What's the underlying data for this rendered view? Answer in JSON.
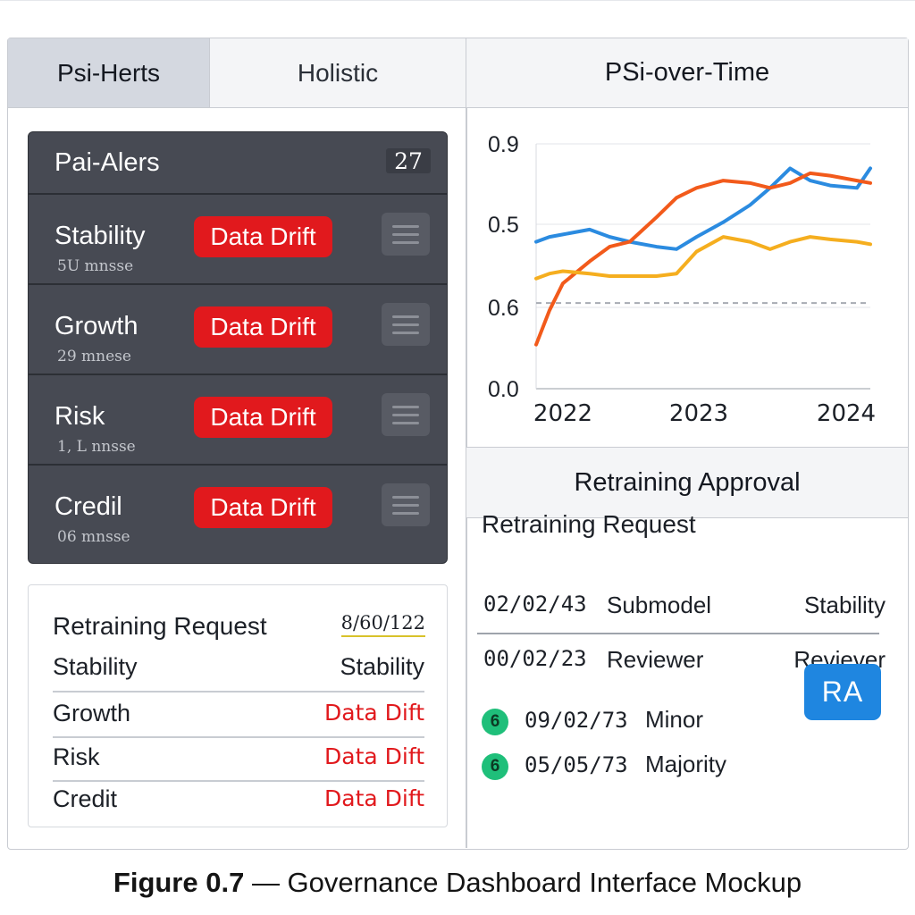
{
  "tabs": {
    "active": "Psi-Herts",
    "inactive": "Holistic"
  },
  "alerts": {
    "title": "Pai-Alers",
    "count": "27",
    "items": [
      {
        "name": "Stability",
        "badge": "Data Drift",
        "sub": "5U mnsse",
        "menu_icon": "hamburger-icon"
      },
      {
        "name": "Growth",
        "badge": "Data Drift",
        "sub": "29 mnese",
        "menu_icon": "hamburger-icon"
      },
      {
        "name": "Risk",
        "badge": "Data Drift",
        "sub": "1, L nnsse",
        "menu_icon": "hamburger-icon"
      },
      {
        "name": "Credil",
        "badge": "Data Drift",
        "sub": "06 mnsse",
        "menu_icon": "hamburger-icon"
      }
    ]
  },
  "request_card": {
    "title": "Retraining Request",
    "date": "8/60/122",
    "rows": [
      {
        "label": "Stability",
        "value": "Stability"
      },
      {
        "label": "Growth",
        "value": "Data Dift"
      },
      {
        "label": "Risk",
        "value": "Data Dift"
      },
      {
        "label": "Credit",
        "value": "Data Dift"
      }
    ]
  },
  "chart_panel": {
    "title": "PSi-over-Time"
  },
  "chart_data": {
    "type": "line",
    "title": "",
    "ytick_labels": [
      "0.9",
      "0.5",
      "0.6",
      "0.0"
    ],
    "xtick_labels": [
      "2022",
      "2023",
      "2024"
    ],
    "x": [
      2021.9,
      2022.0,
      2022.1,
      2022.3,
      2022.45,
      2022.6,
      2022.8,
      2022.95,
      2023.1,
      2023.3,
      2023.5,
      2023.65,
      2023.8,
      2023.95,
      2024.1,
      2024.3,
      2024.4
    ],
    "series": [
      {
        "color": "#2b8be0",
        "values": [
          0.6,
          0.62,
          0.63,
          0.65,
          0.62,
          0.6,
          0.58,
          0.57,
          0.62,
          0.68,
          0.75,
          0.82,
          0.9,
          0.85,
          0.83,
          0.82,
          0.9
        ]
      },
      {
        "color": "#f25a1b",
        "values": [
          0.18,
          0.32,
          0.43,
          0.52,
          0.58,
          0.6,
          0.7,
          0.78,
          0.82,
          0.85,
          0.84,
          0.82,
          0.84,
          0.88,
          0.87,
          0.85,
          0.84
        ]
      },
      {
        "color": "#f5ae1f",
        "values": [
          0.45,
          0.47,
          0.48,
          0.47,
          0.46,
          0.46,
          0.46,
          0.47,
          0.56,
          0.62,
          0.6,
          0.57,
          0.6,
          0.62,
          0.61,
          0.6,
          0.59
        ]
      }
    ],
    "reference_line": 0.35,
    "ylim": [
      0.0,
      1.0
    ],
    "grid": true,
    "legend": "none"
  },
  "approval": {
    "header": "Retraining Approval",
    "title": "Retraining Request",
    "rows": [
      {
        "date": "02/02/43",
        "name": "Submodel",
        "right": "Stability"
      },
      {
        "date": "00/02/23",
        "name": "Reviewer",
        "right": "Reviever"
      }
    ],
    "votes": [
      {
        "icon": "6",
        "date": "09/02/73",
        "label": "Minor"
      },
      {
        "icon": "6",
        "date": "05/05/73",
        "label": "Majority"
      }
    ],
    "button": "RA",
    "colors": {
      "button": "#1f86e0",
      "vote_dot": "#1fbf7a"
    }
  },
  "caption": {
    "figure": "Figure 0.7",
    "text": " — Governance Dashboard Interface Mockup"
  },
  "colors": {
    "drift": "#e1191d",
    "alerts_bg": "#474a53",
    "tab_active": "#d4d8e0"
  }
}
